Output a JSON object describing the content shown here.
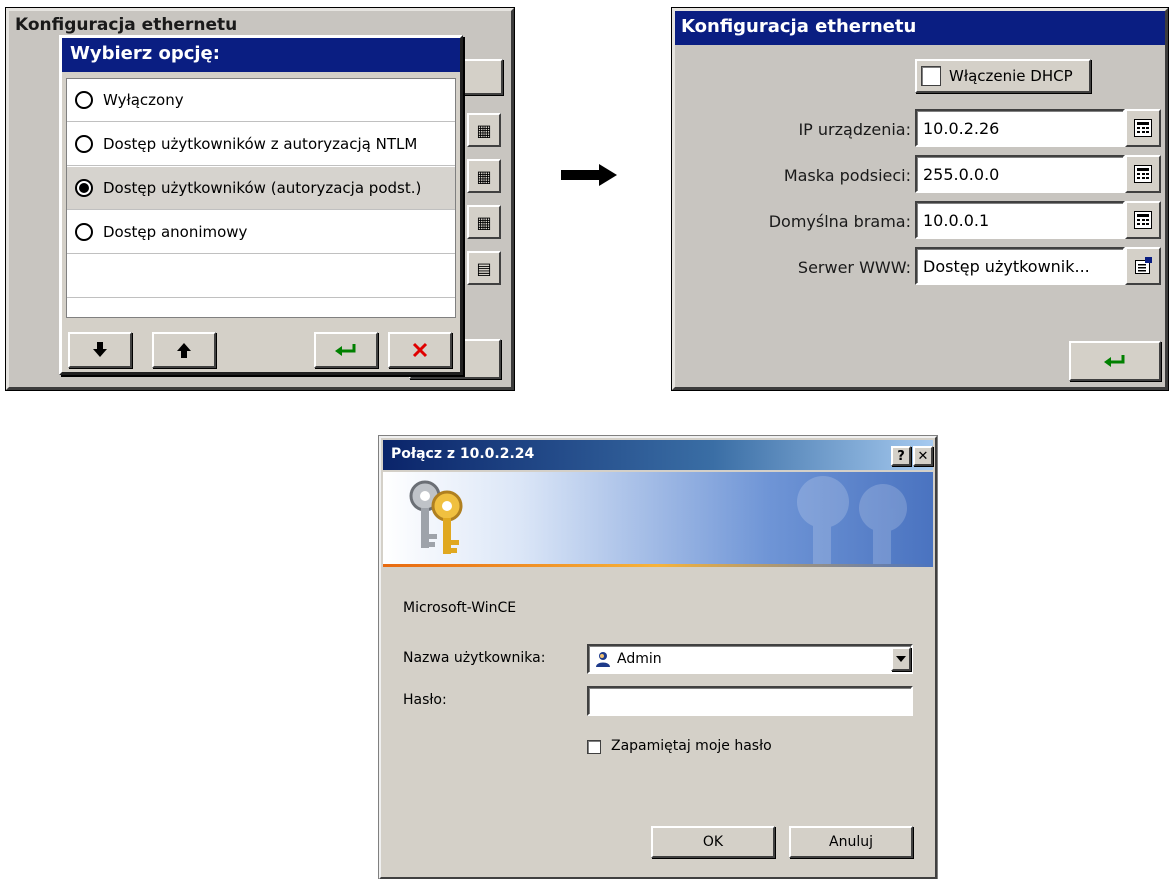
{
  "left_screen": {
    "bg_title_partial": "Konfiguracja ethernetu",
    "popup": {
      "title": "Wybierz opcję:",
      "options": [
        {
          "label": "Wyłączony",
          "selected": false
        },
        {
          "label": "Dostęp użytkowników z autoryzacją NTLM",
          "selected": false
        },
        {
          "label": "Dostęp użytkowników (autoryzacja podst.)",
          "selected": true
        },
        {
          "label": "Dostęp anonimowy",
          "selected": false
        }
      ],
      "buttons": [
        "arrow-down-icon",
        "arrow-up-icon",
        "enter-icon",
        "cancel-x-icon"
      ]
    }
  },
  "arrow": "right-arrow",
  "right_screen": {
    "title": "Konfiguracja ethernetu",
    "dhcp_label": "Włączenie DHCP",
    "dhcp_checked": false,
    "fields": [
      {
        "label": "IP urządzenia:",
        "value": "10.0.2.26",
        "icon": "keypad-icon"
      },
      {
        "label": "Maska podsieci:",
        "value": "255.0.0.0",
        "icon": "keypad-icon"
      },
      {
        "label": "Domyślna brama:",
        "value": "10.0.0.1",
        "icon": "keypad-icon"
      },
      {
        "label": "Serwer WWW:",
        "value": "Dostęp użytkownik...",
        "icon": "options-list-icon"
      }
    ],
    "enter_icon": "enter-icon"
  },
  "login_dialog": {
    "title": "Połącz z 10.0.2.24",
    "help_btn": "?",
    "close_btn": "✕",
    "realm": "Microsoft-WinCE",
    "username_label": "Nazwa użytkownika:",
    "username_value": "Admin",
    "password_label": "Hasło:",
    "password_value": "",
    "remember_label": "Zapamiętaj moje hasło",
    "remember_checked": false,
    "ok": "OK",
    "cancel": "Anuluj"
  }
}
